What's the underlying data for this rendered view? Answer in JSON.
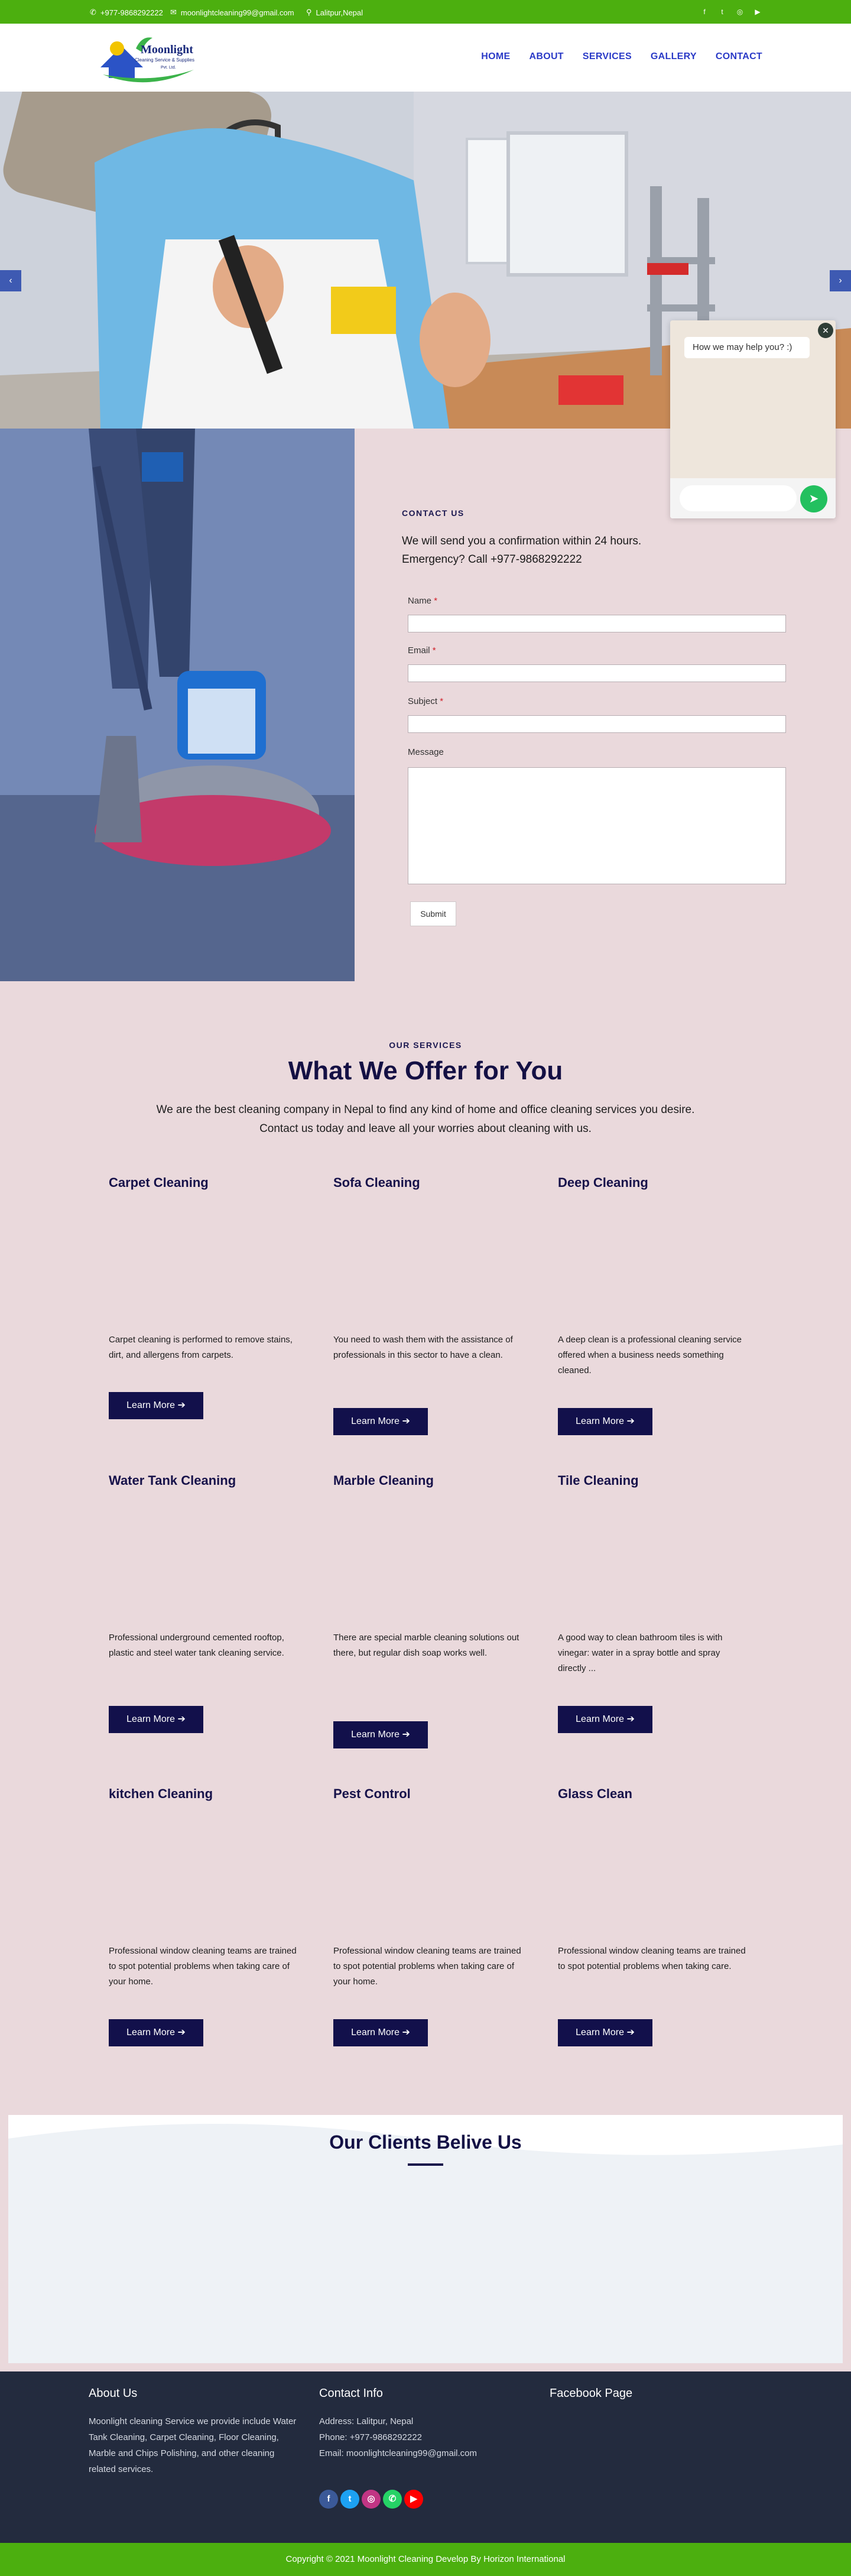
{
  "topbar": {
    "phone": "+977-9868292222",
    "email": "moonlightcleaning99@gmail.com",
    "location": "Lalitpur,Nepal",
    "socials": [
      "facebook-icon",
      "twitter-icon",
      "instagram-icon",
      "youtube-icon"
    ]
  },
  "header": {
    "logo_title": "Moonlight",
    "logo_subtitle": "Cleaning Service & Supplies",
    "logo_tag": "Pvt. Ltd.",
    "nav": [
      "HOME",
      "ABOUT",
      "SERVICES",
      "GALLERY",
      "CONTACT"
    ]
  },
  "hero": {
    "prev_label": "‹",
    "next_label": "›"
  },
  "contact": {
    "kicker": "CONTACT US",
    "line1": "We will send you a confirmation within 24 hours.",
    "line2": "Emergency? Call +977-9868292222",
    "name_label": "Name",
    "email_label": "Email",
    "subject_label": "Subject",
    "message_label": "Message",
    "required_mark": "*",
    "submit": "Submit"
  },
  "chat": {
    "greeting": "How we may help you? :)",
    "close": "✕",
    "send": "➤"
  },
  "services": {
    "kicker": "OUR SERVICES",
    "title": "What We Offer for You",
    "intro1": "We are the best cleaning company in Nepal to find any kind of home and office cleaning services you desire.",
    "intro2": "Contact us today and leave all your worries about cleaning with us.",
    "learn_more": "Learn More",
    "items": [
      {
        "title": "Carpet Cleaning",
        "desc": "Carpet cleaning is performed to remove stains, dirt, and allergens from carpets."
      },
      {
        "title": "Sofa Cleaning",
        "desc": "You need to wash them with the assistance of professionals in this sector to have a clean."
      },
      {
        "title": "Deep Cleaning",
        "desc": "A deep clean is a professional cleaning service offered when a business needs something cleaned."
      },
      {
        "title": "Water Tank Cleaning",
        "desc": "Professional underground cemented rooftop, plastic and steel water tank cleaning service."
      },
      {
        "title": "Marble Cleaning",
        "desc": "There are special marble cleaning solutions out there, but regular dish soap works well."
      },
      {
        "title": "Tile Cleaning",
        "desc": "A good way to clean bathroom tiles is with vinegar: water in a spray bottle and spray directly ..."
      },
      {
        "title": "kitchen Cleaning",
        "desc": "Professional window cleaning teams are trained to spot potential problems when taking care of your home."
      },
      {
        "title": "Pest Control",
        "desc": "Professional window cleaning teams are trained to spot potential problems when taking care of your home."
      },
      {
        "title": "Glass Clean",
        "desc": "Professional window cleaning teams are trained to spot potential problems when taking care."
      }
    ]
  },
  "clients": {
    "title": "Our Clients Belive Us"
  },
  "footer": {
    "about_head": "About Us",
    "about_text": "Moonlight cleaning Service we provide include Water Tank Cleaning, Carpet Cleaning, Floor Cleaning, Marble and Chips Polishing, and other cleaning related services.",
    "contact_head": "Contact Info",
    "address": "Address: Lalitpur, Nepal",
    "phone": "Phone: +977-9868292222",
    "email": "Email: moonlightcleaning99@gmail.com",
    "facebook_head": "Facebook Page",
    "socials": [
      {
        "icon": "facebook-icon",
        "glyph": "f",
        "color": "#3b5998"
      },
      {
        "icon": "twitter-icon",
        "glyph": "t",
        "color": "#1da1f2"
      },
      {
        "icon": "instagram-icon",
        "glyph": "◎",
        "color": "#c13584"
      },
      {
        "icon": "whatsapp-icon",
        "glyph": "✆",
        "color": "#25d366"
      },
      {
        "icon": "youtube-icon",
        "glyph": "▶",
        "color": "#ff0000"
      }
    ],
    "copyright": "Copyright © 2021 Moonlight Cleaning Develop By Horizon International"
  },
  "colors": {
    "brand_green": "#4caf0f",
    "nav_blue": "#2a3ac7",
    "navy": "#12104b",
    "page_bg": "#ead9dc",
    "footer_bg": "#232b3e"
  }
}
